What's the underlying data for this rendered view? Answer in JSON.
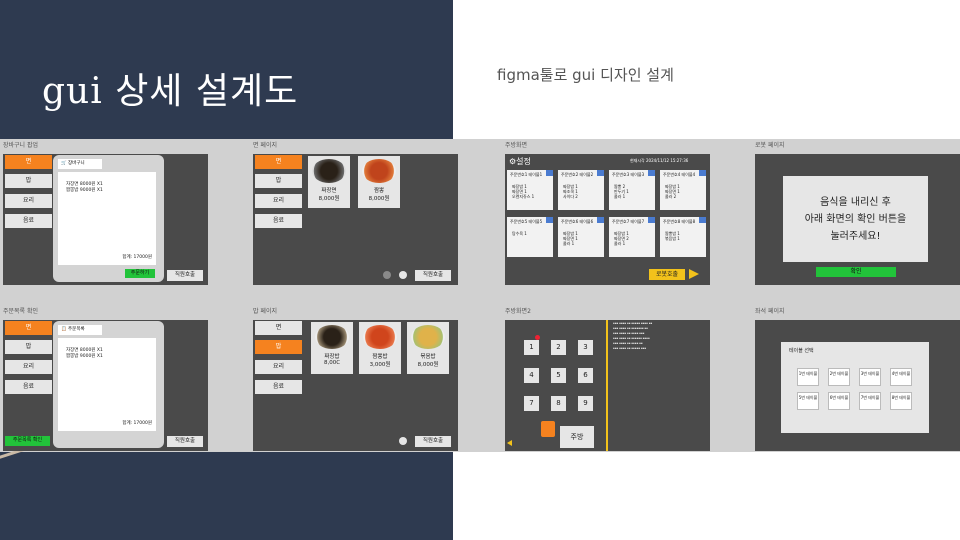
{
  "slide": {
    "title": "gui 상세 설계도",
    "subtitle": "figma툴로 gui 디자인 설계"
  },
  "frames": {
    "cart": {
      "label": "장바구니 팝업",
      "categories": [
        "면",
        "밥",
        "요리",
        "음료"
      ],
      "popup_header": "장바구니",
      "items": [
        "자장면 8000원 X1",
        "짬뽕밥 9000원 X1"
      ],
      "total": "합계: 17000원",
      "order_button": "주문하기",
      "staff_button": "직원호출"
    },
    "noodle": {
      "label": "면 페이지",
      "categories": [
        "면",
        "밥",
        "요리",
        "음료"
      ],
      "dishes": [
        {
          "name": "짜장면",
          "price": "8,000원"
        },
        {
          "name": "짬뽕",
          "price": "8,000원"
        }
      ],
      "staff_button": "직원호출"
    },
    "kitchen": {
      "label": "주방화면",
      "heading": "설정",
      "datetime": "현재시각 2024/11/12 15:27:36",
      "cards": [
        {
          "title": "주문번호1 테이블1",
          "rows": [
            "짜장밥 1",
            "짜장면 1",
            "오렌지쥬스 1"
          ]
        },
        {
          "title": "주문번호2 테이블2",
          "rows": [
            "짜장밥 1",
            "짜조쿡 1",
            "사이다 2"
          ]
        },
        {
          "title": "주문번호3 테이블3",
          "rows": [
            "짬뽕 2",
            "만두기 1",
            "콜라 1"
          ]
        },
        {
          "title": "주문번호4 테이블4",
          "rows": [
            "짜장밥 1",
            "짜장면 1",
            "콜라 2"
          ]
        },
        {
          "title": "주문번호5 테이블5",
          "rows": [
            "탕수육 1"
          ]
        },
        {
          "title": "주문번호6 테이블6",
          "rows": [
            "짜장밥 1",
            "짜장면 1",
            "콜라 1"
          ]
        },
        {
          "title": "주문번호7 테이블7",
          "rows": [
            "짜장밥 1",
            "짜장면 2",
            "콜라 1"
          ]
        },
        {
          "title": "주문번호8 테이블8",
          "rows": [
            "짬뽕밥 1",
            "볶음밥 1"
          ]
        }
      ],
      "robot_button": "로봇호출"
    },
    "robot": {
      "label": "로봇 페이지",
      "message_line1": "음식을 내리신 후",
      "message_line2": "아래 화면의 확인 버튼을",
      "message_line3": "눌러주세요!",
      "confirm_button": "확인"
    },
    "order_confirm": {
      "label": "주문목록 확인",
      "categories": [
        "면",
        "밥",
        "요리",
        "음료"
      ],
      "popup_header": "주문목록",
      "items": [
        "자장면 8000원 X1",
        "짬뽕밥 9000원 X1"
      ],
      "total": "합계: 17000원",
      "confirm_button": "주문목록 확인",
      "staff_button": "직원호출"
    },
    "rice": {
      "label": "밥 페이지",
      "categories": [
        "면",
        "밥",
        "요리",
        "음료"
      ],
      "dishes": [
        {
          "name": "짜장밥",
          "price": "8,00C"
        },
        {
          "name": "짬뽕밥",
          "price": "3,000원"
        },
        {
          "name": "볶음밥",
          "price": "8,000원"
        }
      ],
      "staff_button": "직원호출"
    },
    "kitchen2": {
      "label": "주방화면2",
      "keys": [
        "1",
        "2",
        "3",
        "4",
        "5",
        "6",
        "7",
        "8",
        "9"
      ],
      "kitchen_button": "주방"
    },
    "table_page": {
      "label": "좌석 페이지",
      "heading": "테이블 선택",
      "tables": [
        "1번 테이블",
        "2번 테이블",
        "3번 테이블",
        "4번 테이블",
        "5번 테이블",
        "6번 테이블",
        "7번 테이블",
        "8번 테이블"
      ]
    }
  },
  "colors": {
    "navy": "#2e3a50",
    "orange": "#f5821f",
    "green": "#22c33a",
    "yellow": "#f2c21b",
    "screen": "#4a4a4a"
  }
}
